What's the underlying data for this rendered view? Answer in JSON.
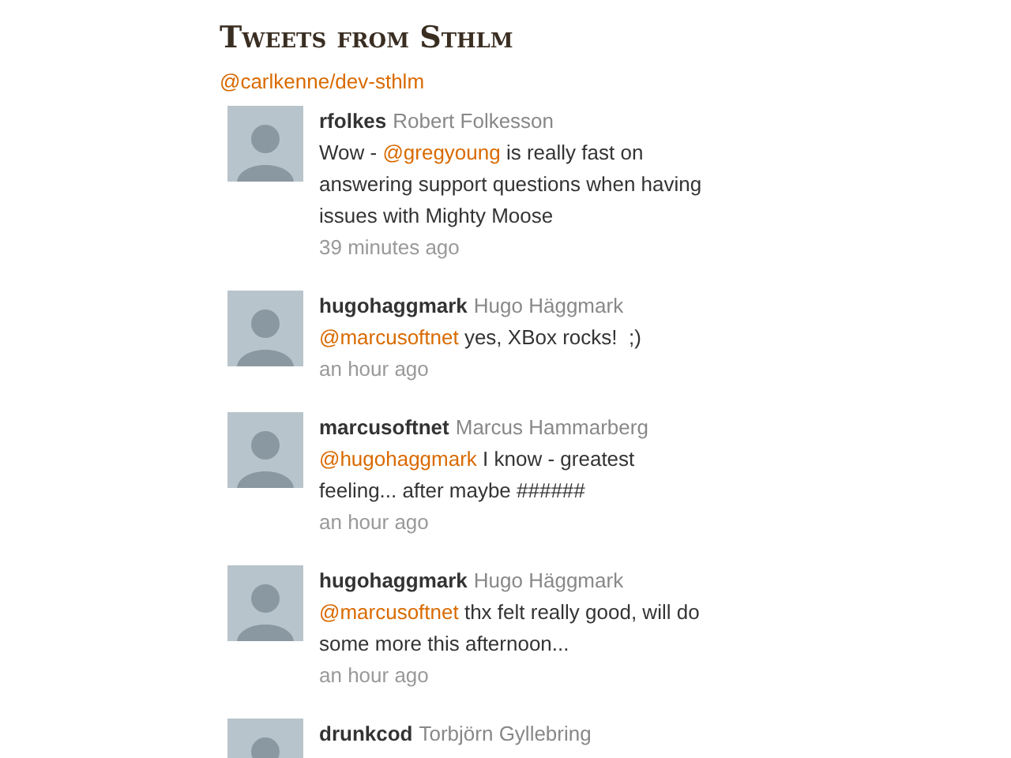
{
  "title": "Tweets from Sthlm",
  "list_link": "@carlkenne/dev-sthlm",
  "tweets": [
    {
      "username": "rfolkes",
      "full_name": "Robert Folkesson",
      "parts": [
        {
          "kind": "text",
          "text": "Wow - "
        },
        {
          "kind": "mention",
          "text": "@gregyoung"
        },
        {
          "kind": "text",
          "text": " is really fast on answering support questions when having issues with Mighty Moose"
        }
      ],
      "time": "39 minutes ago"
    },
    {
      "username": "hugohaggmark",
      "full_name": "Hugo Häggmark",
      "parts": [
        {
          "kind": "mention",
          "text": "@marcusoftnet"
        },
        {
          "kind": "text",
          "text": " yes, XBox rocks!  ;)"
        }
      ],
      "time": "an hour ago"
    },
    {
      "username": "marcusoftnet",
      "full_name": "Marcus Hammarberg",
      "parts": [
        {
          "kind": "mention",
          "text": "@hugohaggmark"
        },
        {
          "kind": "text",
          "text": " I know - greatest feeling... after maybe ######"
        }
      ],
      "time": "an hour ago"
    },
    {
      "username": "hugohaggmark",
      "full_name": "Hugo Häggmark",
      "parts": [
        {
          "kind": "mention",
          "text": "@marcusoftnet"
        },
        {
          "kind": "text",
          "text": " thx felt really good, will do some more this afternoon..."
        }
      ],
      "time": "an hour ago"
    },
    {
      "username": "drunkcod",
      "full_name": "Torbjörn Gyllebring"
    }
  ]
}
